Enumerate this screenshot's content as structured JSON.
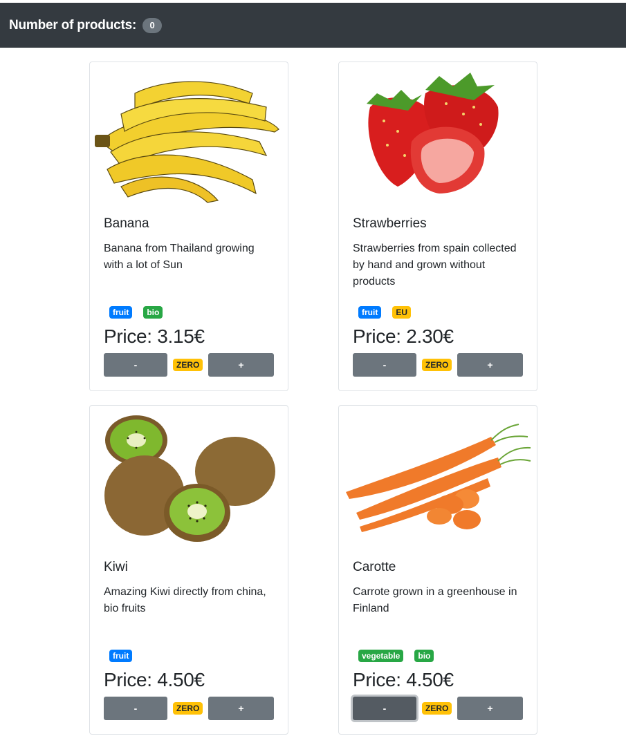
{
  "navbar": {
    "title": "Number of products:",
    "count": "0"
  },
  "colors": {
    "navbar": "#343a40",
    "badge_fruit": "#007bff",
    "badge_bio": "#28a745",
    "badge_eu": "#ffc107",
    "button": "#6c757d"
  },
  "products": [
    {
      "name": "Banana",
      "description": "Banana from Thailand growing with a lot of Sun",
      "tags": [
        "fruit",
        "bio"
      ],
      "price": "Price: 3.15€",
      "minus_label": "-",
      "zero_label": "ZERO",
      "plus_label": "+",
      "image": "banana-bunch"
    },
    {
      "name": "Strawberries",
      "description": "Strawberries from spain collected by hand and grown without products",
      "tags": [
        "fruit",
        "EU"
      ],
      "price": "Price: 2.30€",
      "minus_label": "-",
      "zero_label": "ZERO",
      "plus_label": "+",
      "image": "strawberries"
    },
    {
      "name": "Kiwi",
      "description": "Amazing Kiwi directly from china, bio fruits",
      "tags": [
        "fruit"
      ],
      "price": "Price: 4.50€",
      "minus_label": "-",
      "zero_label": "ZERO",
      "plus_label": "+",
      "image": "kiwis"
    },
    {
      "name": "Carotte",
      "description": "Carrote grown in a greenhouse in Finland",
      "tags": [
        "vegetable",
        "bio"
      ],
      "price": "Price: 4.50€",
      "minus_label": "-",
      "zero_label": "ZERO",
      "plus_label": "+",
      "image": "carrots"
    }
  ]
}
